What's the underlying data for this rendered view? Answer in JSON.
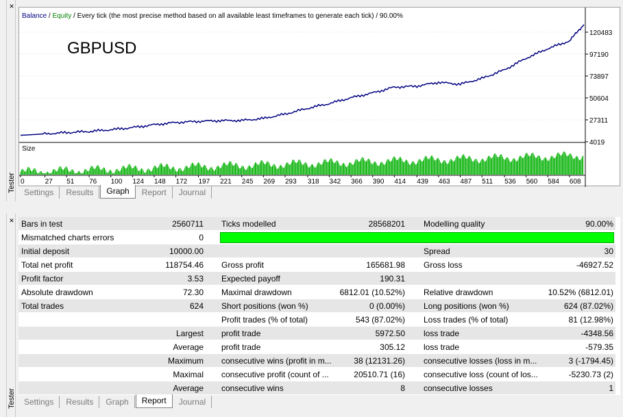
{
  "chart": {
    "legend_balance": "Balance",
    "legend_sep1": " / ",
    "legend_equity": "Equity",
    "legend_rest": " / Every tick (the most precise method based on all available least timeframes to generate each tick) / 90.00%",
    "symbol": "GBPUSD",
    "size_label": "Size",
    "colors": {
      "balance": "#000080",
      "equity": "#008000",
      "size": "#00b000"
    }
  },
  "chart_data": {
    "type": "line",
    "title": "",
    "x": [
      0,
      27,
      51,
      76,
      100,
      124,
      148,
      172,
      197,
      221,
      245,
      269,
      293,
      318,
      342,
      366,
      390,
      414,
      439,
      463,
      487,
      511,
      536,
      560,
      584,
      608,
      624
    ],
    "x_ticks": [
      "0",
      "27",
      "51",
      "76",
      "100",
      "124",
      "148",
      "172",
      "197",
      "221",
      "245",
      "269",
      "293",
      "318",
      "342",
      "366",
      "390",
      "414",
      "439",
      "463",
      "487",
      "511",
      "536",
      "560",
      "584",
      "608"
    ],
    "y_ticks": [
      "120483",
      "97190",
      "73897",
      "50604",
      "27311",
      "4019"
    ],
    "ylim": [
      4019,
      127000
    ],
    "series": [
      {
        "name": "Balance",
        "x": [
          0,
          27,
          51,
          76,
          100,
          124,
          148,
          172,
          197,
          221,
          245,
          269,
          293,
          318,
          342,
          366,
          390,
          414,
          439,
          463,
          487,
          511,
          536,
          560,
          584,
          608,
          624
        ],
        "values": [
          10000,
          11500,
          12800,
          14000,
          15800,
          18000,
          21000,
          23300,
          24500,
          25200,
          25400,
          27500,
          32000,
          38000,
          43000,
          49000,
          54000,
          60000,
          61000,
          65000,
          63000,
          69000,
          78000,
          90000,
          100000,
          108000,
          125000
        ]
      }
    ]
  },
  "tabs": [
    "Settings",
    "Results",
    "Graph",
    "Report",
    "Journal"
  ],
  "side_label": "Tester",
  "close_icon": "×",
  "report": {
    "rows": [
      [
        "Bars in test",
        "2560711",
        "Ticks modelled",
        "28568201",
        "Modelling quality",
        "90.00%"
      ],
      [
        "Mismatched charts errors",
        "0",
        "",
        "",
        "",
        ""
      ],
      [
        "Initial deposit",
        "10000.00",
        "",
        "",
        "Spread",
        "30"
      ],
      [
        "Total net profit",
        "118754.46",
        "Gross profit",
        "165681.98",
        "Gross loss",
        "-46927.52"
      ],
      [
        "Profit factor",
        "3.53",
        "Expected payoff",
        "190.31",
        "",
        ""
      ],
      [
        "Absolute drawdown",
        "72.30",
        "Maximal drawdown",
        "6812.01 (10.52%)",
        "Relative drawdown",
        "10.52% (6812.01)"
      ],
      [
        "Total trades",
        "624",
        "Short positions (won %)",
        "0 (0.00%)",
        "Long positions (won %)",
        "624 (87.02%)"
      ],
      [
        "",
        "",
        "Profit trades (% of total)",
        "543 (87.02%)",
        "Loss trades (% of total)",
        "81 (12.98%)"
      ],
      [
        "",
        "Largest",
        "profit trade",
        "5972.50",
        "loss trade",
        "-4348.56"
      ],
      [
        "",
        "Average",
        "profit trade",
        "305.12",
        "loss trade",
        "-579.35"
      ],
      [
        "",
        "Maximum",
        "consecutive wins (profit in m...",
        "38 (12131.26)",
        "consecutive losses (loss in m...",
        "3 (-1794.45)"
      ],
      [
        "",
        "Maximal",
        "consecutive profit (count of ...",
        "20510.71 (16)",
        "consecutive loss (count of los...",
        "-5230.73 (2)"
      ],
      [
        "",
        "Average",
        "consecutive wins",
        "8",
        "consecutive losses",
        "1"
      ]
    ]
  }
}
